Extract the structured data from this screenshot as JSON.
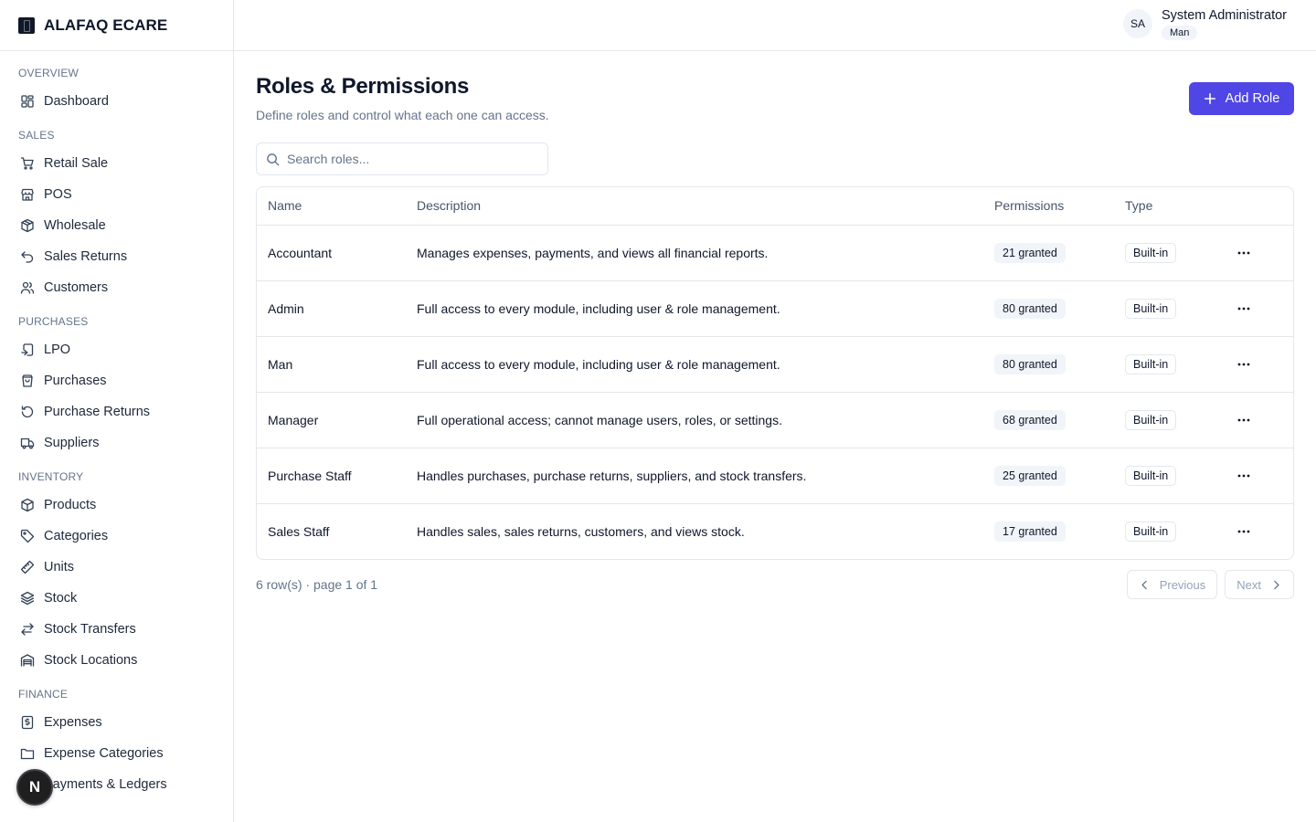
{
  "app": {
    "name": "ALAFAQ ECARE"
  },
  "sidebar": {
    "sections": [
      {
        "title": "OVERVIEW",
        "items": [
          {
            "label": "Dashboard",
            "icon": "dashboard-icon"
          }
        ]
      },
      {
        "title": "SALES",
        "items": [
          {
            "label": "Retail Sale",
            "icon": "cart-icon"
          },
          {
            "label": "POS",
            "icon": "store-icon"
          },
          {
            "label": "Wholesale",
            "icon": "package-icon"
          },
          {
            "label": "Sales Returns",
            "icon": "undo-icon"
          },
          {
            "label": "Customers",
            "icon": "users-icon"
          }
        ]
      },
      {
        "title": "PURCHASES",
        "items": [
          {
            "label": "LPO",
            "icon": "clipboard-icon"
          },
          {
            "label": "Purchases",
            "icon": "shopping-bag-icon"
          },
          {
            "label": "Purchase Returns",
            "icon": "rotate-icon"
          },
          {
            "label": "Suppliers",
            "icon": "truck-icon"
          }
        ]
      },
      {
        "title": "INVENTORY",
        "items": [
          {
            "label": "Products",
            "icon": "box-icon"
          },
          {
            "label": "Categories",
            "icon": "tag-icon"
          },
          {
            "label": "Units",
            "icon": "ruler-icon"
          },
          {
            "label": "Stock",
            "icon": "layers-icon"
          },
          {
            "label": "Stock Transfers",
            "icon": "transfer-icon"
          },
          {
            "label": "Stock Locations",
            "icon": "warehouse-icon"
          }
        ]
      },
      {
        "title": "FINANCE",
        "items": [
          {
            "label": "Expenses",
            "icon": "receipt-icon"
          },
          {
            "label": "Expense Categories",
            "icon": "folder-icon"
          },
          {
            "label": "Payments & Ledgers",
            "icon": "wallet-icon"
          }
        ]
      }
    ]
  },
  "header": {
    "user": {
      "initials": "SA",
      "name": "System Administrator",
      "role": "Man"
    }
  },
  "page": {
    "title": "Roles & Permissions",
    "subtitle": "Define roles and control what each one can access.",
    "add_button": "Add Role",
    "search_placeholder": "Search roles..."
  },
  "table": {
    "columns": [
      "Name",
      "Description",
      "Permissions",
      "Type"
    ],
    "rows": [
      {
        "name": "Accountant",
        "description": "Manages expenses, payments, and views all financial reports.",
        "permissions": "21 granted",
        "type": "Built-in"
      },
      {
        "name": "Admin",
        "description": "Full access to every module, including user & role management.",
        "permissions": "80 granted",
        "type": "Built-in"
      },
      {
        "name": "Man",
        "description": "Full access to every module, including user & role management.",
        "permissions": "80 granted",
        "type": "Built-in"
      },
      {
        "name": "Manager",
        "description": "Full operational access; cannot manage users, roles, or settings.",
        "permissions": "68 granted",
        "type": "Built-in"
      },
      {
        "name": "Purchase Staff",
        "description": "Handles purchases, purchase returns, suppliers, and stock transfers.",
        "permissions": "25 granted",
        "type": "Built-in"
      },
      {
        "name": "Sales Staff",
        "description": "Handles sales, sales returns, customers, and views stock.",
        "permissions": "17 granted",
        "type": "Built-in"
      }
    ]
  },
  "footer": {
    "count": "6 row(s) · page 1 of 1",
    "previous": "Previous",
    "next": "Next"
  },
  "floating_badge": {
    "letter": "N"
  },
  "colors": {
    "accent": "#4f46e5",
    "border": "#e5e7eb",
    "muted": "#64748b"
  }
}
